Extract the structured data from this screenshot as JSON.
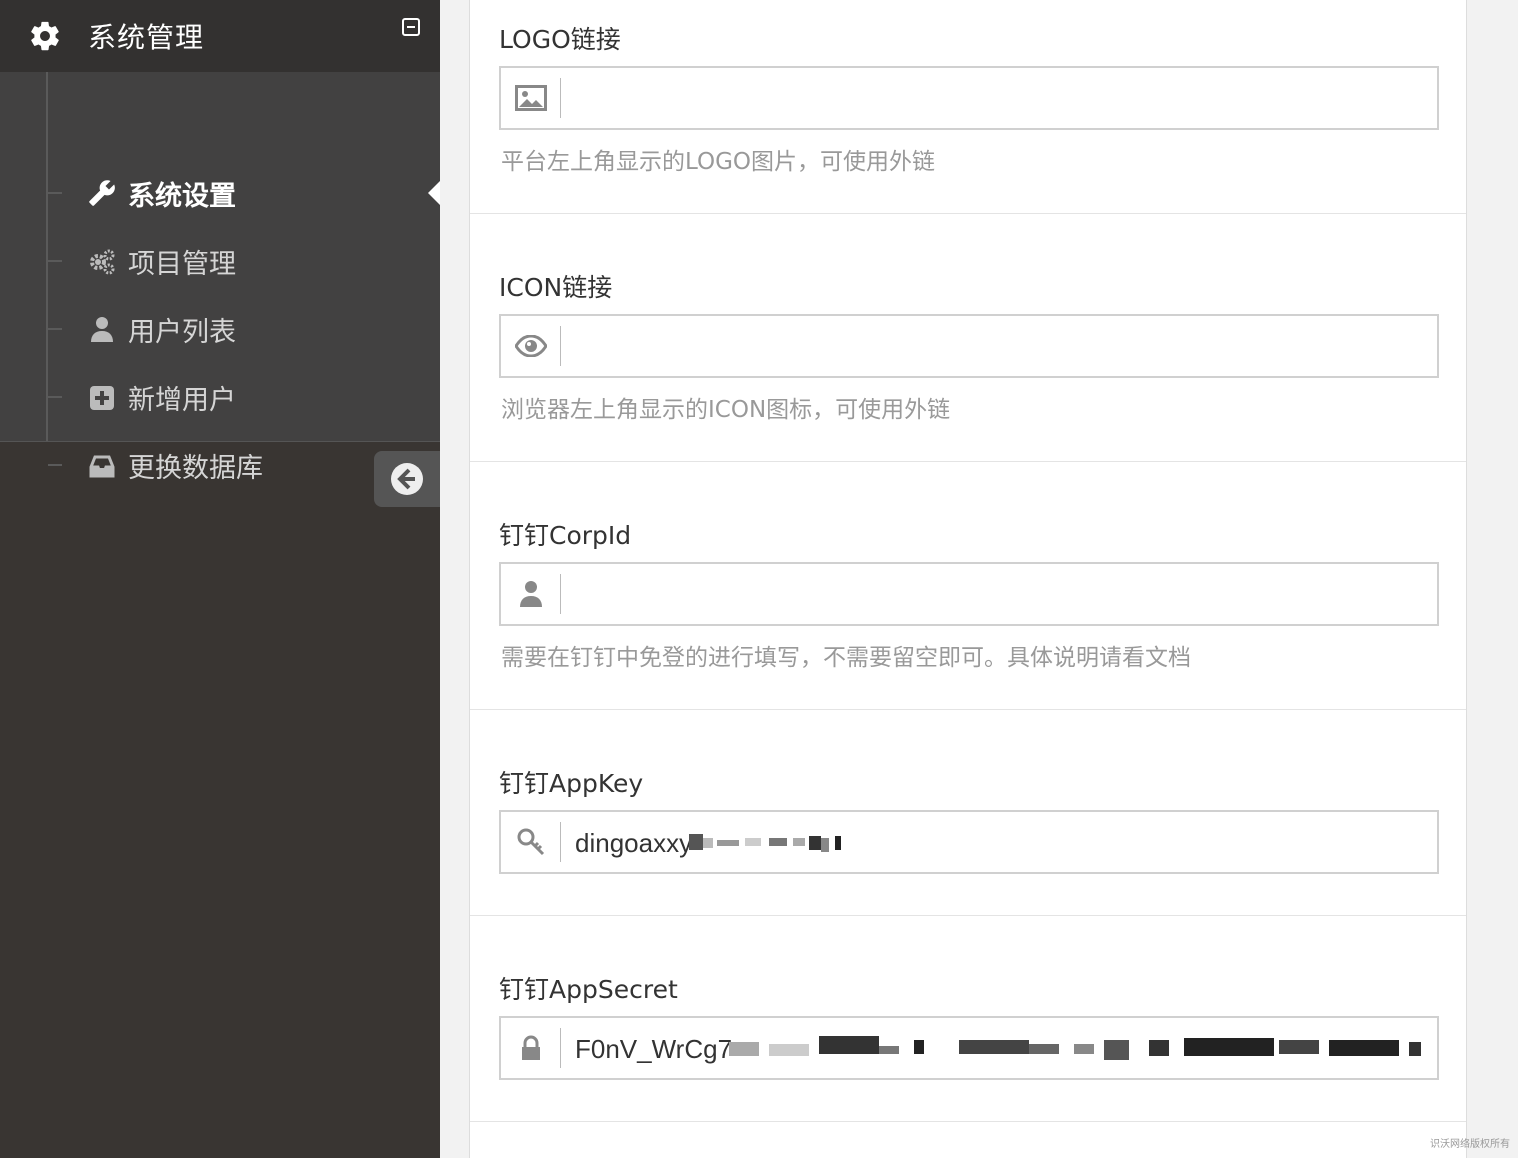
{
  "sidebar": {
    "header_title": "系统管理",
    "items": [
      {
        "label": "系统设置",
        "icon": "wrench-icon",
        "active": true
      },
      {
        "label": "项目管理",
        "icon": "gears-icon",
        "active": false
      },
      {
        "label": "用户列表",
        "icon": "user-icon",
        "active": false
      },
      {
        "label": "新增用户",
        "icon": "plus-square-icon",
        "active": false
      },
      {
        "label": "更换数据库",
        "icon": "inbox-icon",
        "active": false
      }
    ]
  },
  "form": {
    "logo": {
      "label": "LOGO链接",
      "value": "",
      "help": "平台左上角显示的LOGO图片，可使用外链",
      "icon": "image-icon"
    },
    "icon": {
      "label": "ICON链接",
      "value": "",
      "help": "浏览器左上角显示的ICON图标，可使用外链",
      "icon": "eye-icon"
    },
    "corpid": {
      "label": "钉钉CorpId",
      "value": "",
      "help": "需要在钉钉中免登的进行填写，不需要留空即可。具体说明请看文档",
      "icon": "user-icon"
    },
    "appkey": {
      "label": "钉钉AppKey",
      "value": "dingoaxxy",
      "icon": "key-icon"
    },
    "appsecret": {
      "label": "钉钉AppSecret",
      "value": "F0nV_WrCg7",
      "icon": "lock-icon"
    }
  },
  "watermark": "识沃网络版权所有",
  "colors": {
    "sidebar_bg": "#393532",
    "submenu_bg": "#424141",
    "panel_bg": "#ffffff"
  }
}
